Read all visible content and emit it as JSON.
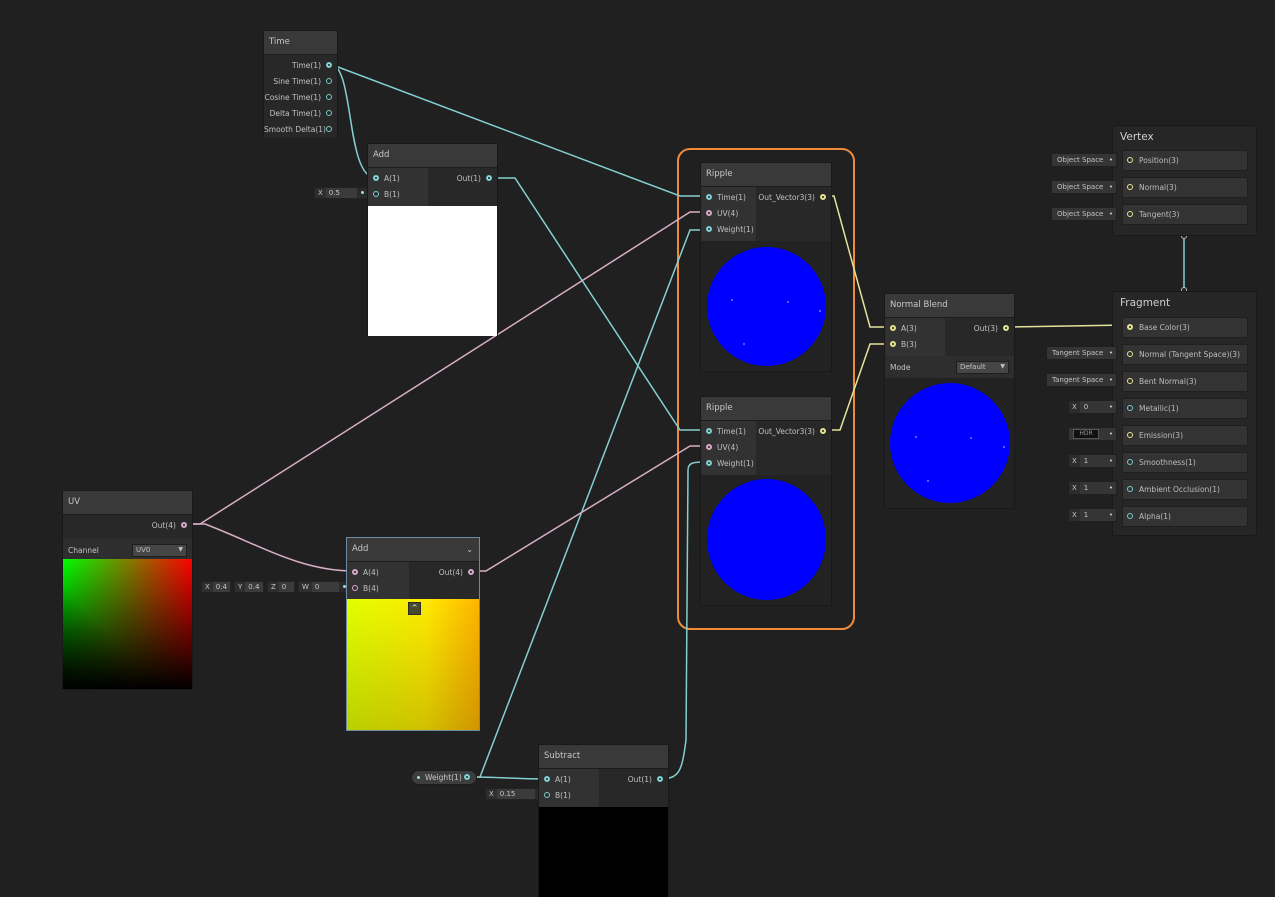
{
  "nodes": {
    "time": {
      "title": "Time",
      "outputs": [
        "Time(1)",
        "Sine Time(1)",
        "Cosine Time(1)",
        "Delta Time(1)",
        "Smooth Delta(1)"
      ]
    },
    "add_top": {
      "title": "Add",
      "inputs": [
        "A(1)",
        "B(1)"
      ],
      "output": "Out(1)",
      "b_field": {
        "label": "X",
        "value": "0.5"
      },
      "preview_color": "#ffffff"
    },
    "uv": {
      "title": "UV",
      "output": "Out(4)",
      "channel_label": "Channel",
      "channel_value": "UV0"
    },
    "add_mid": {
      "title": "Add",
      "inputs": [
        "A(4)",
        "B(4)"
      ],
      "output": "Out(4)",
      "b_fields": [
        {
          "label": "X",
          "value": "0.4"
        },
        {
          "label": "Y",
          "value": "0.4"
        },
        {
          "label": "Z",
          "value": "0"
        },
        {
          "label": "W",
          "value": "0"
        }
      ]
    },
    "ripple_top": {
      "title": "Ripple",
      "inputs": [
        "Time(1)",
        "UV(4)",
        "Weight(1)"
      ],
      "output": "Out_Vector3(3)",
      "preview_color": "#0000ff"
    },
    "ripple_bottom": {
      "title": "Ripple",
      "inputs": [
        "Time(1)",
        "UV(4)",
        "Weight(1)"
      ],
      "output": "Out_Vector3(3)",
      "preview_color": "#0000ff"
    },
    "normal_blend": {
      "title": "Normal Blend",
      "inputs": [
        "A(3)",
        "B(3)"
      ],
      "output": "Out(3)",
      "mode_label": "Mode",
      "mode_value": "Default",
      "preview_color": "#0000ff"
    },
    "weight_property": {
      "label": "Weight(1)"
    },
    "subtract": {
      "title": "Subtract",
      "inputs": [
        "A(1)",
        "B(1)"
      ],
      "output": "Out(1)",
      "b_field": {
        "label": "X",
        "value": "0.15"
      },
      "preview_color": "#000000"
    }
  },
  "vertex": {
    "title": "Vertex",
    "blocks": [
      {
        "label": "Position(3)",
        "space": "Object Space"
      },
      {
        "label": "Normal(3)",
        "space": "Object Space"
      },
      {
        "label": "Tangent(3)",
        "space": "Object Space"
      }
    ]
  },
  "fragment": {
    "title": "Fragment",
    "blocks": [
      {
        "label": "Base Color(3)"
      },
      {
        "label": "Normal (Tangent Space)(3)",
        "space": "Tangent Space"
      },
      {
        "label": "Bent Normal(3)",
        "space": "Tangent Space"
      },
      {
        "label": "Metallic(1)",
        "x_label": "X",
        "value": "0"
      },
      {
        "label": "Emission(3)",
        "hdr": "HDR"
      },
      {
        "label": "Smoothness(1)",
        "x_label": "X",
        "value": "1"
      },
      {
        "label": "Ambient Occlusion(1)",
        "x_label": "X",
        "value": "1"
      },
      {
        "label": "Alpha(1)",
        "x_label": "X",
        "value": "1"
      }
    ]
  },
  "colors": {
    "canvas": "#202020",
    "wire_float": "#84cfd0",
    "wire_vector4": "#d8aec6",
    "wire_vector3": "#e3e39a",
    "group_outline": "#f08b3a",
    "preview_blue": "#0000ff"
  }
}
